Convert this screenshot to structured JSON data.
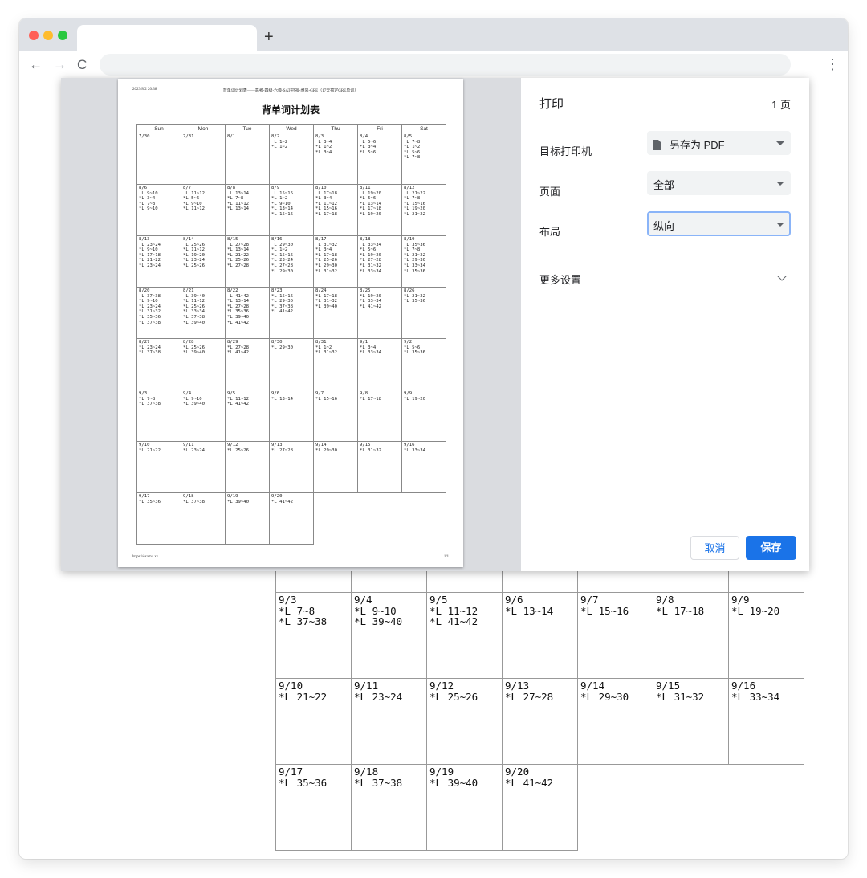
{
  "browser": {
    "new_tab_symbol": "+",
    "back_symbol": "←",
    "forward_symbol": "→",
    "reload_symbol": "C",
    "menu_symbol": "⋮"
  },
  "background_calendar": {
    "rows": [
      [
        "",
        "",
        "",
        "",
        "",
        "",
        ""
      ],
      [
        "9/3\n*L 7~8\n*L 37~38",
        "9/4\n*L 9~10\n*L 39~40",
        "9/5\n*L 11~12\n*L 41~42",
        "9/6\n*L 13~14",
        "9/7\n*L 15~16",
        "9/8\n*L 17~18",
        "9/9\n*L 19~20"
      ],
      [
        "9/10\n*L 21~22",
        "9/11\n*L 23~24",
        "9/12\n*L 25~26",
        "9/13\n*L 27~28",
        "9/14\n*L 29~30",
        "9/15\n*L 31~32",
        "9/16\n*L 33~34"
      ],
      [
        "9/17\n*L 35~36",
        "9/18\n*L 37~38",
        "9/19\n*L 39~40",
        "9/20\n*L 41~42"
      ]
    ]
  },
  "preview": {
    "header_left": "2023/8/2 20:38",
    "header_center": "背单词计划表——高考-四级-六级-SAT-托福-雅思-GRE（17天搞定GRE单词）",
    "title": "背单词计划表",
    "footer_left": "https://exam4.xx",
    "footer_right": "1/1",
    "weekdays": [
      "Sun",
      "Mon",
      "Tue",
      "Wed",
      "Thu",
      "Fri",
      "Sat"
    ],
    "weeks": [
      [
        "7/30",
        "7/31",
        "8/1",
        "8/2\n L 1~2\n*L 1~2",
        "8/3\n L 3~4\n*L 1~2\n*L 3~4",
        "8/4\n L 5~6\n*L 3~4\n*L 5~6",
        "8/5\n L 7~8\n*L 1~2\n*L 5~6\n*L 7~8"
      ],
      [
        "8/6\n L 9~10\n*L 3~4\n*L 7~8\n*L 9~10",
        "8/7\n L 11~12\n*L 5~6\n*L 9~10\n*L 11~12",
        "8/8\n L 13~14\n*L 7~8\n*L 11~12\n*L 13~14",
        "8/9\n L 15~16\n*L 1~2\n*L 9~10\n*L 13~14\n*L 15~16",
        "8/10\n L 17~18\n*L 3~4\n*L 11~12\n*L 15~16\n*L 17~18",
        "8/11\n L 19~20\n*L 5~6\n*L 13~14\n*L 17~18\n*L 19~20",
        "8/12\n L 21~22\n*L 7~8\n*L 15~16\n*L 19~20\n*L 21~22"
      ],
      [
        "8/13\n L 23~24\n*L 9~10\n*L 17~18\n*L 21~22\n*L 23~24",
        "8/14\n L 25~26\n*L 11~12\n*L 19~20\n*L 23~24\n*L 25~26",
        "8/15\n L 27~28\n*L 13~14\n*L 21~22\n*L 25~26\n*L 27~28",
        "8/16\n L 29~30\n*L 1~2\n*L 15~16\n*L 23~24\n*L 27~28\n*L 29~30",
        "8/17\n L 31~32\n*L 3~4\n*L 17~18\n*L 25~26\n*L 29~30\n*L 31~32",
        "8/18\n L 33~34\n*L 5~6\n*L 19~20\n*L 27~28\n*L 31~32\n*L 33~34",
        "8/19\n L 35~36\n*L 7~8\n*L 21~22\n*L 29~30\n*L 33~34\n*L 35~36"
      ],
      [
        "8/20\n L 37~38\n*L 9~10\n*L 23~24\n*L 31~32\n*L 35~36\n*L 37~38",
        "8/21\n L 39~40\n*L 11~12\n*L 25~26\n*L 33~34\n*L 37~38\n*L 39~40",
        "8/22\n L 41~42\n*L 13~14\n*L 27~28\n*L 35~36\n*L 39~40\n*L 41~42",
        "8/23\n*L 15~16\n*L 29~30\n*L 37~38\n*L 41~42",
        "8/24\n*L 17~18\n*L 31~32\n*L 39~40",
        "8/25\n*L 19~20\n*L 33~34\n*L 41~42",
        "8/26\n*L 21~22\n*L 35~36"
      ],
      [
        "8/27\n*L 23~24\n*L 37~38",
        "8/28\n*L 25~26\n*L 39~40",
        "8/29\n*L 27~28\n*L 41~42",
        "8/30\n*L 29~30",
        "8/31\n*L 1~2\n*L 31~32",
        "9/1\n*L 3~4\n*L 33~34",
        "9/2\n*L 5~6\n*L 35~36"
      ],
      [
        "9/3\n*L 7~8\n*L 37~38",
        "9/4\n*L 9~10\n*L 39~40",
        "9/5\n*L 11~12\n*L 41~42",
        "9/6\n*L 13~14",
        "9/7\n*L 15~16",
        "9/8\n*L 17~18",
        "9/9\n*L 19~20"
      ],
      [
        "9/10\n*L 21~22",
        "9/11\n*L 23~24",
        "9/12\n*L 25~26",
        "9/13\n*L 27~28",
        "9/14\n*L 29~30",
        "9/15\n*L 31~32",
        "9/16\n*L 33~34"
      ],
      [
        "9/17\n*L 35~36",
        "9/18\n*L 37~38",
        "9/19\n*L 39~40",
        "9/20\n*L 41~42"
      ]
    ]
  },
  "print_settings": {
    "title": "打印",
    "page_count": "1 页",
    "destination_label": "目标打印机",
    "destination_value": "另存为 PDF",
    "destination_icon": "document-icon",
    "pages_label": "页面",
    "pages_value": "全部",
    "layout_label": "布局",
    "layout_value": "纵向",
    "more_settings": "更多设置",
    "cancel_button": "取消",
    "save_button": "保存",
    "accent_color": "#1a73e8"
  }
}
